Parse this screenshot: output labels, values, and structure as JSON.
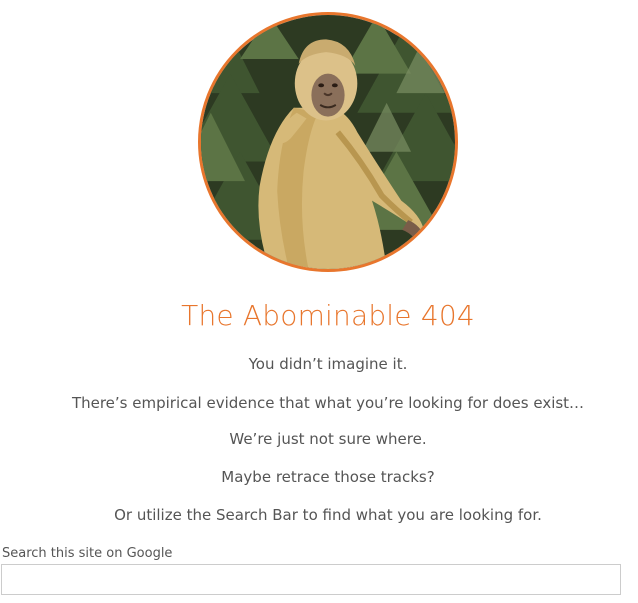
{
  "hero": {
    "image_alt": "Bigfoot walking through pine trees",
    "accent_color": "#e8762d"
  },
  "page": {
    "title": "The Abominable 404",
    "lines": [
      "You didn’t imagine it.",
      "There’s empirical evidence that what you’re looking for does exist…",
      "We’re just not sure where.",
      "Maybe retrace those tracks?",
      "Or utilize the Search Bar to find what you are looking for."
    ]
  },
  "search": {
    "label": "Search this site on Google",
    "value": "",
    "placeholder": ""
  }
}
